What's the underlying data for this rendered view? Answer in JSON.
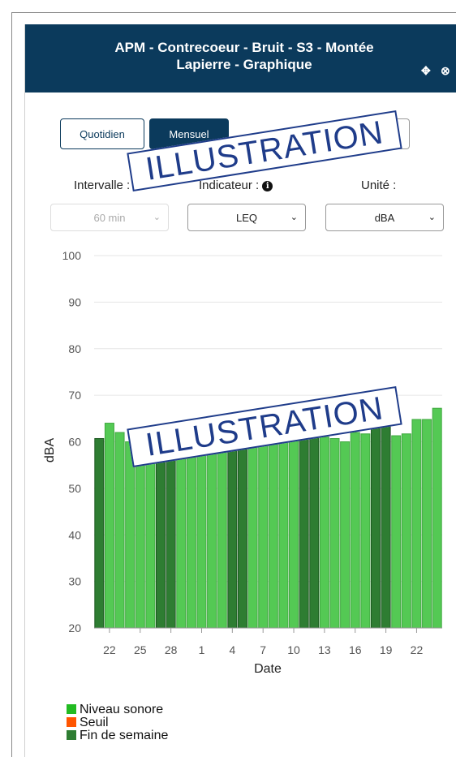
{
  "header": {
    "title_line1": "APM - Contrecoeur - Bruit - S3 - Montée",
    "title_line2": "Lapierre  - Graphique",
    "icons": [
      "move-icon",
      "close-icon"
    ]
  },
  "tabs": [
    {
      "label": "Quotidien",
      "active": false
    },
    {
      "label": "Mensuel",
      "active": true
    }
  ],
  "controls": {
    "interval_label": "Intervalle :",
    "indicator_label": "Indicateur :",
    "unit_label": "Unité :",
    "interval_value": "60 min",
    "indicator_value": "LEQ",
    "unit_value": "dBA"
  },
  "watermark": "ILLUSTRATION",
  "colors": {
    "header_bg": "#0b3a5c",
    "bar_normal": "#54c954",
    "bar_weekend": "#2e7d32",
    "legend_normal": "#22bb22",
    "legend_seuil": "#ff5500",
    "legend_weekend": "#2e7d32"
  },
  "legend": [
    {
      "label": "Niveau sonore",
      "color": "#22bb22"
    },
    {
      "label": "Seuil",
      "color": "#ff5500"
    },
    {
      "label": "Fin de semaine",
      "color": "#2e7d32"
    }
  ],
  "chart_data": {
    "type": "bar",
    "xlabel": "Date",
    "ylabel": "dBA",
    "ylim": [
      20,
      100
    ],
    "yticks": [
      20,
      30,
      40,
      50,
      60,
      70,
      80,
      90,
      100
    ],
    "grid": true,
    "legend_position": "bottom-left",
    "tick_labels": [
      "22",
      "25",
      "28",
      "1",
      "4",
      "7",
      "10",
      "13",
      "16",
      "19",
      "22"
    ],
    "series": [
      {
        "name": "Niveau sonore",
        "values": [
          60.7,
          64.0,
          62.0,
          60.0,
          58.0,
          57.0,
          58.0,
          56.0,
          57.0,
          58.0,
          57.5,
          58.0,
          58.5,
          59.0,
          59.0,
          59.5,
          60.0,
          60.0,
          60.5,
          61.0,
          61.0,
          61.5,
          61.0,
          60.7,
          60.0,
          62.0,
          61.7,
          63.4,
          63.4,
          61.3,
          61.7,
          64.8,
          64.8,
          67.2
        ]
      }
    ],
    "weekend": [
      true,
      false,
      false,
      false,
      false,
      false,
      true,
      true,
      false,
      false,
      false,
      false,
      false,
      true,
      true,
      false,
      false,
      false,
      false,
      false,
      true,
      true,
      false,
      false,
      false,
      false,
      false,
      true,
      true,
      false,
      false,
      false,
      false,
      false
    ]
  }
}
